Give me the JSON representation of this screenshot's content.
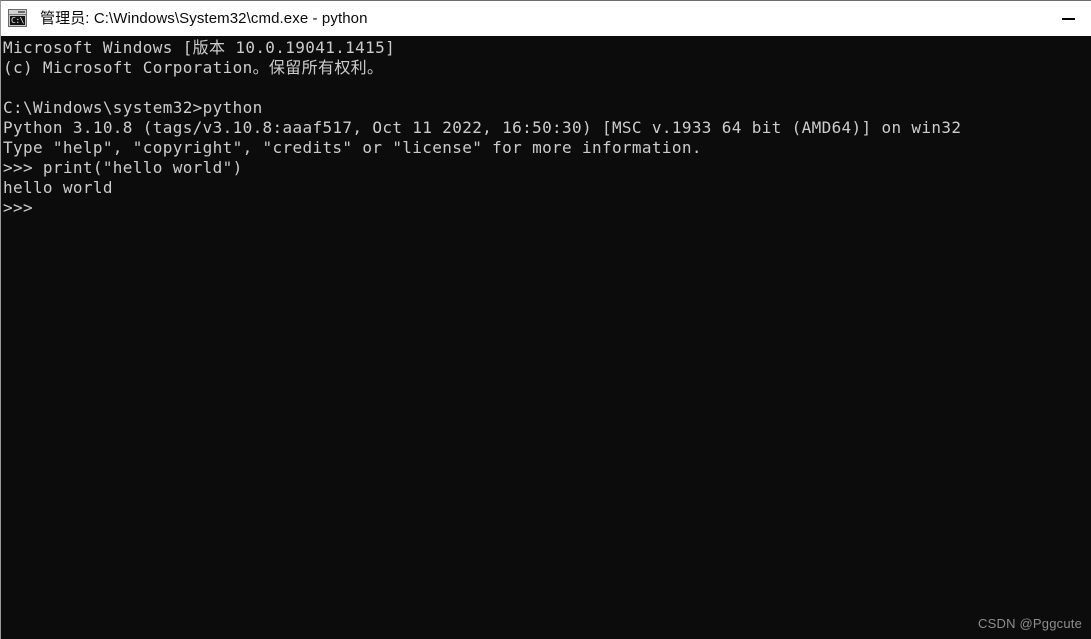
{
  "window": {
    "title": "管理员: C:\\Windows\\System32\\cmd.exe - python",
    "icon_label": "C:\\.",
    "background_color": "#0c0c0c",
    "titlebar_color": "#ffffff",
    "text_color": "#cccccc",
    "buttons": {
      "minimize": "—"
    }
  },
  "console": {
    "lines": [
      "Microsoft Windows [版本 10.0.19041.1415]",
      "(c) Microsoft Corporation。保留所有权利。",
      "",
      "C:\\Windows\\system32>python",
      "Python 3.10.8 (tags/v3.10.8:aaaf517, Oct 11 2022, 16:50:30) [MSC v.1933 64 bit (AMD64)] on win32",
      "Type \"help\", \"copyright\", \"credits\" or \"license\" for more information.",
      ">>> print(\"hello world\")",
      "hello world",
      ">>> "
    ]
  },
  "watermark": {
    "text": "CSDN @Pggcute"
  }
}
